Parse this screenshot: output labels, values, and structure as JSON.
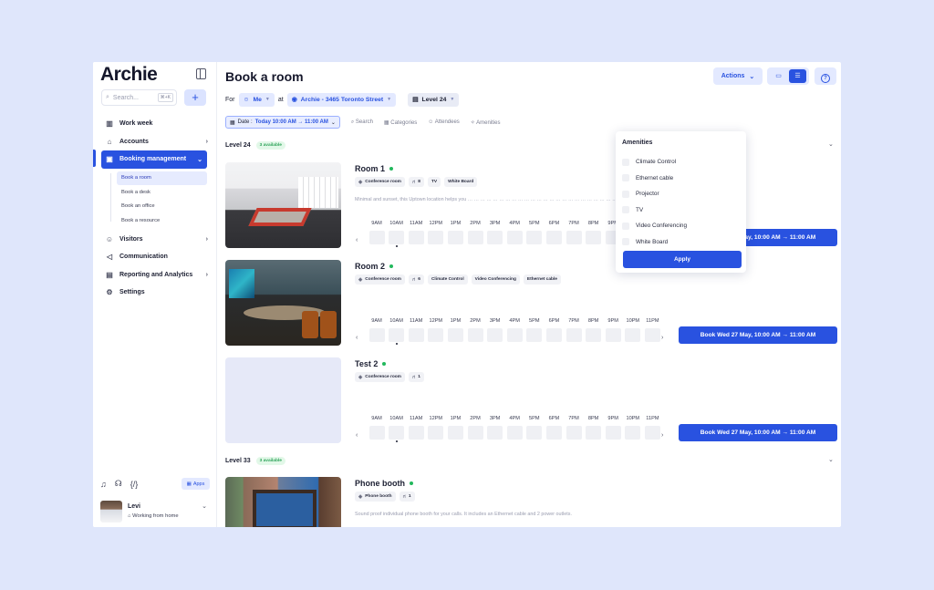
{
  "sidebar": {
    "logo": "Archie",
    "search_placeholder": "Search...",
    "search_shortcut": "⌘+K",
    "add_label": "+",
    "nav": [
      {
        "label": "Work week",
        "icon": "building-icon"
      },
      {
        "label": "Accounts",
        "icon": "bank-icon"
      },
      {
        "label": "Booking management",
        "icon": "calendar-icon",
        "active": true
      }
    ],
    "subnav": [
      "Book a room",
      "Book a desk",
      "Book an office",
      "Book a resource"
    ],
    "nav2": [
      {
        "label": "Visitors",
        "icon": "person-icon"
      },
      {
        "label": "Communication",
        "icon": "megaphone-icon"
      },
      {
        "label": "Reporting and Analytics",
        "icon": "chart-icon"
      },
      {
        "label": "Settings",
        "icon": "gear-icon"
      }
    ],
    "apps_label": "Apps",
    "user": {
      "name": "Levi",
      "status": "Working from home"
    }
  },
  "header": {
    "title": "Book a room",
    "actions_label": "Actions",
    "for_label": "For",
    "me_label": "Me",
    "at_label": "at",
    "location": "Archie - 3465 Toronto Street",
    "level": "Level 24"
  },
  "filters": {
    "date_prefix": "Date :",
    "date_value": "Today 10:00 AM → 11:00 AM",
    "search": "Search",
    "categories": "Categories",
    "attendees": "Attendees",
    "amenities": "Amenities"
  },
  "levels": [
    {
      "name": "Level 24",
      "badge": "3 available"
    },
    {
      "name": "Level 33",
      "badge": "3 available"
    }
  ],
  "timeslots": [
    "9AM",
    "10AM",
    "11AM",
    "12PM",
    "1PM",
    "2PM",
    "3PM",
    "4PM",
    "5PM",
    "6PM",
    "7PM",
    "8PM",
    "9PM",
    "10PM",
    "11PM"
  ],
  "rooms": [
    {
      "name": "Room 1",
      "tags": [
        {
          "icon": "cube-icon",
          "text": "Conference room"
        },
        {
          "icon": "seat-icon",
          "text": "8"
        },
        {
          "icon": "",
          "text": "TV"
        },
        {
          "icon": "",
          "text": "White Board"
        }
      ],
      "desc": "Minimal and sunset, this Uptown location helps you … … … … … … … … … … … … … … … … … … … … … … … … … … study or wor…",
      "book": "Book Wed 27 May, 10:00 AM → 11:00 AM"
    },
    {
      "name": "Room 2",
      "tags": [
        {
          "icon": "cube-icon",
          "text": "Conference room"
        },
        {
          "icon": "seat-icon",
          "text": "6"
        },
        {
          "icon": "",
          "text": "Climate Control"
        },
        {
          "icon": "",
          "text": "Video Conferencing"
        },
        {
          "icon": "",
          "text": "Ethernet cable"
        }
      ],
      "book": "Book Wed 27 May, 10:00 AM → 11:00 AM"
    },
    {
      "name": "Test 2",
      "tags": [
        {
          "icon": "cube-icon",
          "text": "Conference room"
        },
        {
          "icon": "seat-icon",
          "text": "1"
        }
      ],
      "book": "Book Wed 27 May, 10:00 AM → 11:00 AM"
    },
    {
      "name": "Phone booth",
      "tags": [
        {
          "icon": "cube-icon",
          "text": "Phone booth"
        },
        {
          "icon": "seat-icon",
          "text": "1"
        }
      ],
      "desc": "Sound proof individual phone booth for your calls. It includes an Ethernet cable and 2 power outlets."
    }
  ],
  "amenities_panel": {
    "title": "Amenities",
    "options": [
      "Climate Control",
      "Ethernet cable",
      "Projector",
      "TV",
      "Video Conferencing",
      "White Board"
    ],
    "apply": "Apply"
  },
  "colors": {
    "accent": "#2952e0",
    "available": "#22b85c",
    "background": "#dfe6fb"
  }
}
